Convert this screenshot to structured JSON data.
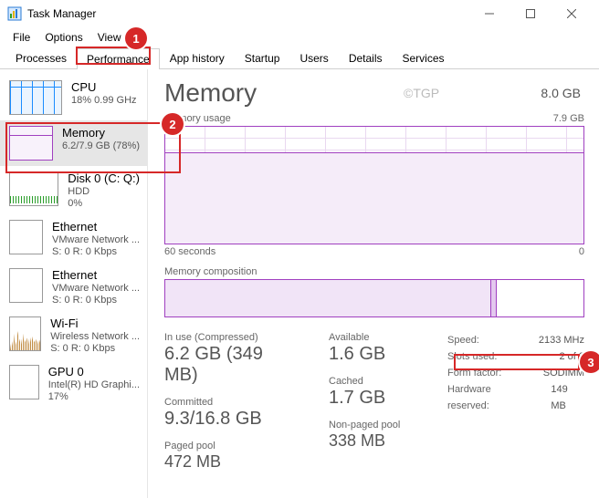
{
  "window": {
    "title": "Task Manager"
  },
  "menu": {
    "file": "File",
    "options": "Options",
    "view": "View"
  },
  "tabs": {
    "processes": "Processes",
    "performance": "Performance",
    "apphistory": "App history",
    "startup": "Startup",
    "users": "Users",
    "details": "Details",
    "services": "Services"
  },
  "sidebar": [
    {
      "title": "CPU",
      "sub1": "18%  0.99 GHz",
      "sub2": ""
    },
    {
      "title": "Memory",
      "sub1": "6.2/7.9 GB (78%)",
      "sub2": ""
    },
    {
      "title": "Disk 0 (C: Q:)",
      "sub1": "HDD",
      "sub2": "0%"
    },
    {
      "title": "Ethernet",
      "sub1": "VMware Network ...",
      "sub2": "S: 0  R: 0 Kbps"
    },
    {
      "title": "Ethernet",
      "sub1": "VMware Network ...",
      "sub2": "S: 0  R: 0 Kbps"
    },
    {
      "title": "Wi-Fi",
      "sub1": "Wireless Network ...",
      "sub2": "S: 0  R: 0 Kbps"
    },
    {
      "title": "GPU 0",
      "sub1": "Intel(R) HD Graphi...",
      "sub2": "17%"
    }
  ],
  "main": {
    "title": "Memory",
    "total": "8.0 GB",
    "watermark": "©TGP",
    "usage_label": "Memory usage",
    "usage_max": "7.9 GB",
    "axis_left": "60 seconds",
    "axis_right": "0",
    "comp_label": "Memory composition",
    "stats": {
      "in_use_lbl": "In use (Compressed)",
      "in_use_val": "6.2 GB (349 MB)",
      "available_lbl": "Available",
      "available_val": "1.6 GB",
      "committed_lbl": "Committed",
      "committed_val": "9.3/16.8 GB",
      "cached_lbl": "Cached",
      "cached_val": "1.7 GB",
      "paged_lbl": "Paged pool",
      "paged_val": "472 MB",
      "nonpaged_lbl": "Non-paged pool",
      "nonpaged_val": "338 MB"
    },
    "hw": {
      "speed_k": "Speed:",
      "speed_v": "2133 MHz",
      "slots_k": "Slots used:",
      "slots_v": "2 of 2",
      "form_k": "Form factor:",
      "form_v": "SODIMM",
      "reserved_k": "Hardware reserved:",
      "reserved_v": "149 MB"
    }
  },
  "callouts": {
    "c1": "1",
    "c2": "2",
    "c3": "3"
  },
  "chart_data": {
    "type": "area",
    "title": "Memory usage",
    "ylabel": "GB",
    "ylim": [
      0,
      7.9
    ],
    "x_span_seconds": 60,
    "series": [
      {
        "name": "In use",
        "value_gb": 6.2,
        "percent": 78
      }
    ],
    "composition": {
      "in_use_gb": 6.2,
      "total_gb": 7.9
    }
  }
}
